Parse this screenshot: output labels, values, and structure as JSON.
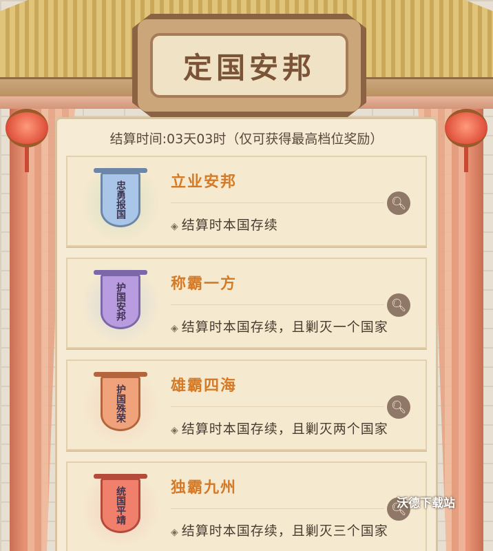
{
  "header": {
    "title": "定国安邦",
    "settle_text": "结算时间:03天03时（仅可获得最高档位奖励）"
  },
  "tiers": [
    {
      "name": "立业安邦",
      "condition": "结算时本国存续",
      "banner_text": "忠勇报国",
      "banner_color": "#a9c6e8",
      "border_color": "#6d86a8",
      "glow_color": "#b6d6b9"
    },
    {
      "name": "称霸一方",
      "condition": "结算时本国存续，且剿灭一个国家",
      "banner_text": "护国安邦",
      "banner_color": "#b99be0",
      "border_color": "#7c68a8",
      "glow_color": "#b9c9e6"
    },
    {
      "name": "雄霸四海",
      "condition": "结算时本国存续，且剿灭两个国家",
      "banner_text": "护国殊荣",
      "banner_color": "#f0a27a",
      "border_color": "#b3663e",
      "glow_color": "#f2c4b0"
    },
    {
      "name": "独霸九州",
      "condition": "结算时本国存续，且剿灭三个国家",
      "banner_text": "统国平靖",
      "banner_color": "#f07f6c",
      "border_color": "#b34a3a",
      "glow_color": "#f4b9ae"
    }
  ],
  "icons": {
    "search": "search-icon",
    "bullet": "diamond-bullet-icon"
  },
  "watermark": "沃德下载站"
}
